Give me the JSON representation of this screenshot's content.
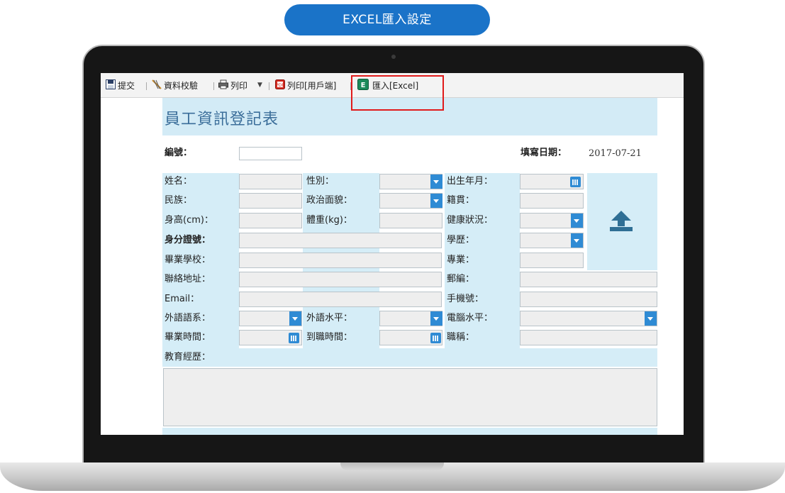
{
  "badge": {
    "label": "EXCEL匯入設定"
  },
  "toolbar": {
    "submit_label": "提交",
    "validate_label": "資料校驗",
    "print_label": "列印",
    "print_client_label": "列印[用戶端]",
    "import_excel_label": "匯入[Excel]"
  },
  "form": {
    "title": "員工資訊登記表",
    "serial_label": "編號：",
    "serial_value": "",
    "fill_date_label": "填寫日期：",
    "fill_date_value": "2017-07-21",
    "rows": {
      "name_label": "姓名：",
      "gender_label": "性別：",
      "birth_label": "出生年月：",
      "ethnicity_label": "民族：",
      "political_label": "政治面貌：",
      "native_label": "籍貫：",
      "height_label": "身高(cm)：",
      "weight_label": "體重(kg)：",
      "health_label": "健康狀況：",
      "id_label": "身分證號：",
      "education_label": "學歷：",
      "school_label": "畢業學校：",
      "major_label": "專業：",
      "address_label": "聯絡地址：",
      "zip_label": "郵編：",
      "email_label": "Email：",
      "mobile_label": "手機號：",
      "language_label": "外語語系：",
      "language_level_label": "外語水平：",
      "computer_level_label": "電腦水平：",
      "grad_time_label": "畢業時間：",
      "join_time_label": "到職時間：",
      "title_label": "職稱：",
      "edu_history_label": "教育經歷："
    }
  },
  "colors": {
    "accent": "#1a73c8",
    "highlight": "#e01b1b",
    "cell": "#d5edf7"
  }
}
